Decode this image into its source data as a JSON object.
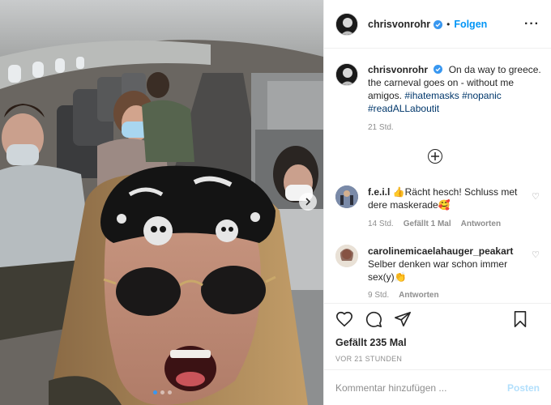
{
  "post": {
    "username": "chrisvonrohr",
    "follow_label": "Folgen",
    "more_icon": "more-horizontal-icon",
    "caption": {
      "username": "chrisvonrohr",
      "text": "On da way to greece. the carneval goes on - without me amigos.",
      "hashtags": [
        "#ihatemasks",
        "#nopanic",
        "#readALLaboutit"
      ],
      "time": "21 Std."
    },
    "comments": [
      {
        "username": "f.e.i.l",
        "text": "👍Rächt hesch! Schluss met dere maskerade🥰",
        "time": "14 Std.",
        "likes": "Gefällt 1 Mal",
        "reply": "Antworten"
      },
      {
        "username": "carolinemicaelahauger_peakart",
        "text": "Selber denken war schon immer sex(y)👏",
        "time": "9 Std.",
        "reply": "Antworten"
      }
    ],
    "likes_label": "Gefällt 235 Mal",
    "posted_time": "VOR 21 STUNDEN",
    "comment_placeholder": "Kommentar hinzufügen ...",
    "post_button": "Posten"
  },
  "colors": {
    "accent": "#0095f6",
    "verified": "#3897f0",
    "muted": "#8e8e8e",
    "hashtag": "#00376b",
    "post_disabled": "#b2dffc"
  },
  "carousel": {
    "current": 1,
    "total": 3
  }
}
